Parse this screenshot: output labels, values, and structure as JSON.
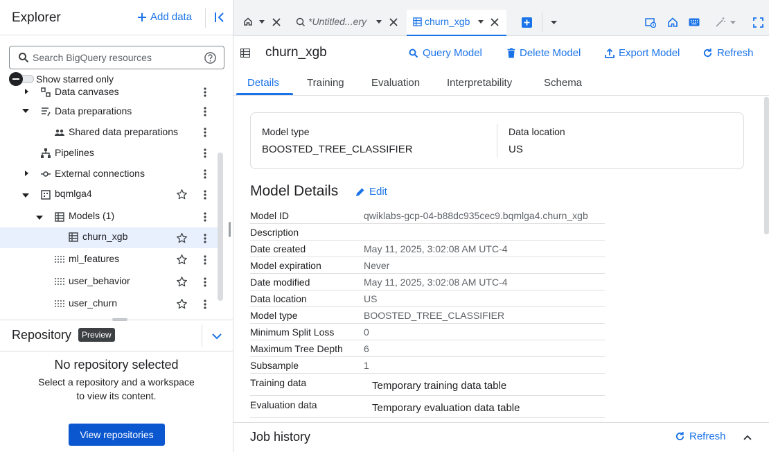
{
  "explorer": {
    "title": "Explorer",
    "add_data_label": "Add data",
    "search_placeholder": "Search BigQuery resources",
    "show_starred_label": "Show starred only",
    "tree": [
      {
        "label": "Data canvases"
      },
      {
        "label": "Data preparations"
      },
      {
        "label": "Shared data preparations"
      },
      {
        "label": "Pipelines"
      },
      {
        "label": "External connections"
      },
      {
        "label": "bqmlga4"
      },
      {
        "label": "Models (1)"
      },
      {
        "label": "churn_xgb"
      },
      {
        "label": "ml_features"
      },
      {
        "label": "user_behavior"
      },
      {
        "label": "user_churn"
      }
    ]
  },
  "repository": {
    "title": "Repository",
    "badge": "Preview",
    "empty_title": "No repository selected",
    "empty_desc": "Select a repository and a workspace to view its content.",
    "button_label": "View repositories"
  },
  "tabs": {
    "untitled_label": "*Untitled...ery",
    "active_label": "churn_xgb"
  },
  "header": {
    "title": "churn_xgb",
    "query_model": "Query Model",
    "delete_model": "Delete Model",
    "export_model": "Export Model",
    "refresh": "Refresh"
  },
  "subtabs": [
    "Details",
    "Training",
    "Evaluation",
    "Interpretability",
    "Schema"
  ],
  "summary": {
    "model_type_label": "Model type",
    "model_type_value": "BOOSTED_TREE_CLASSIFIER",
    "data_location_label": "Data location",
    "data_location_value": "US"
  },
  "details": {
    "title": "Model Details",
    "edit_label": "Edit",
    "rows": [
      {
        "key": "Model ID",
        "value": "qwiklabs-gcp-04-b88dc935cec9.bqmlga4.churn_xgb"
      },
      {
        "key": "Description",
        "value": ""
      },
      {
        "key": "Date created",
        "value": "May 11, 2025, 3:02:08 AM UTC-4"
      },
      {
        "key": "Model expiration",
        "value": "Never"
      },
      {
        "key": "Date modified",
        "value": "May 11, 2025, 3:02:08 AM UTC-4"
      },
      {
        "key": "Data location",
        "value": "US"
      },
      {
        "key": "Model type",
        "value": "BOOSTED_TREE_CLASSIFIER"
      },
      {
        "key": "Minimum Split Loss",
        "value": "0"
      },
      {
        "key": "Maximum Tree Depth",
        "value": "6"
      },
      {
        "key": "Subsample",
        "value": "1"
      },
      {
        "key": "Training data",
        "value": "Temporary training data table"
      },
      {
        "key": "Evaluation data",
        "value": "Temporary evaluation data table"
      }
    ]
  },
  "job_history": {
    "title": "Job history",
    "refresh": "Refresh"
  },
  "colors": {
    "accent": "#1a73e8",
    "primary_button": "#0b57d0",
    "selected_row": "#e8f0fe"
  }
}
